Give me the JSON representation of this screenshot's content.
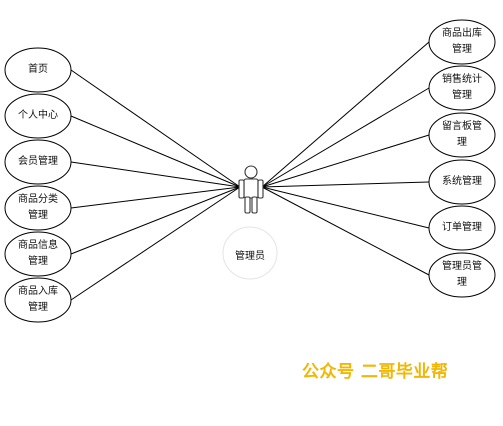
{
  "actor": {
    "label": "管理员"
  },
  "left_use_cases": [
    {
      "label": "首页"
    },
    {
      "label": "个人中心"
    },
    {
      "label": "会员管理"
    },
    {
      "label": "商品分类\n管理"
    },
    {
      "label": "商品信息\n管理"
    },
    {
      "label": "商品入库\n管理"
    }
  ],
  "right_use_cases": [
    {
      "label": "商品出库\n管理"
    },
    {
      "label": "销售统计\n管理"
    },
    {
      "label": "留言板管\n理"
    },
    {
      "label": "系统管理"
    },
    {
      "label": "订单管理"
    },
    {
      "label": "管理员管\n理"
    }
  ],
  "watermark": "公众号 二哥毕业帮"
}
